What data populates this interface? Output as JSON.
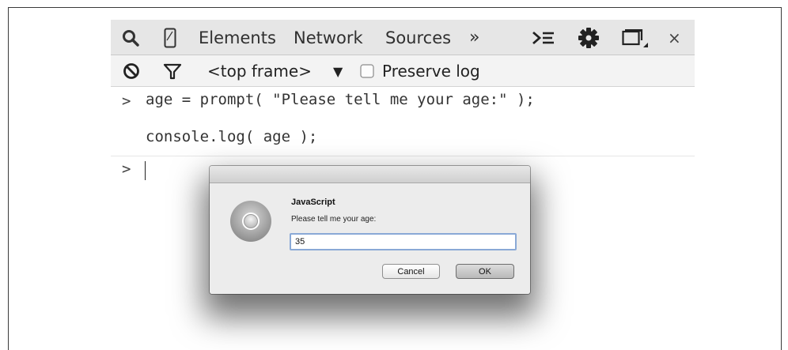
{
  "tabs": {
    "elements": "Elements",
    "network": "Network",
    "sources": "Sources",
    "more": "»",
    "close": "×"
  },
  "toolbar": {
    "frame_selector": "<top frame>",
    "frame_dropdown_arrow": "▼",
    "preserve_log_label": "Preserve log",
    "preserve_log_checked": false
  },
  "console": {
    "prompt_symbol": ">",
    "entries": [
      "age = prompt( \"Please tell me your age:\" );",
      "console.log( age );"
    ],
    "current_input": ""
  },
  "dialog": {
    "title": "JavaScript",
    "message": "Please tell me your age:",
    "input_value": "35",
    "cancel_label": "Cancel",
    "ok_label": "OK"
  },
  "icons": {
    "search": "search-icon",
    "device": "device-mode-icon",
    "drawer": "console-drawer-icon",
    "settings": "gear-icon",
    "dock": "dock-side-icon",
    "clear": "clear-console-icon",
    "filter": "filter-icon",
    "app": "chrome-app-icon"
  }
}
